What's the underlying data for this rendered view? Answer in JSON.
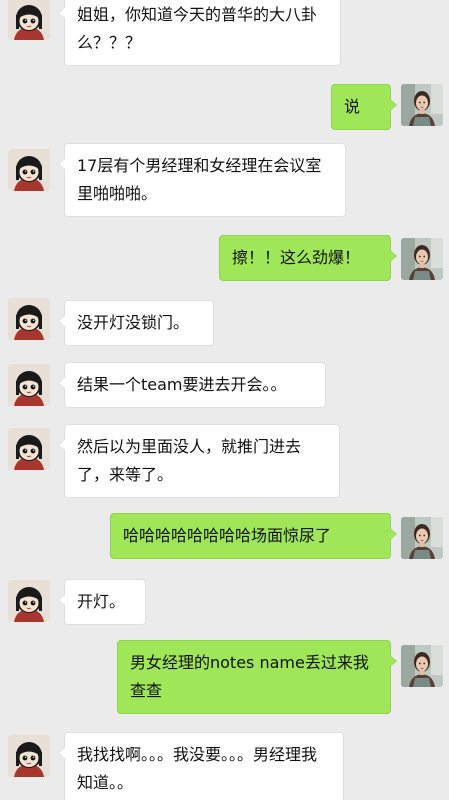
{
  "messages": [
    {
      "side": "left",
      "text": "姐姐，你知道今天的普华的大八卦么？？？"
    },
    {
      "side": "right",
      "text": "说"
    },
    {
      "side": "left",
      "text": "17层有个男经理和女经理在会议室里啪啪啪。"
    },
    {
      "side": "right",
      "text": "擦！！这么劲爆！"
    },
    {
      "side": "left",
      "text": "没开灯没锁门。"
    },
    {
      "side": "left",
      "text": "结果一个team要进去开会。。"
    },
    {
      "side": "left",
      "text": "然后以为里面没人，就推门进去了，来等了。"
    },
    {
      "side": "right",
      "text": "哈哈哈哈哈哈哈哈场面惊尿了"
    },
    {
      "side": "left",
      "text": "开灯。"
    },
    {
      "side": "right",
      "text": "男女经理的notes name丢过来我查查"
    },
    {
      "side": "left",
      "text": "我找找啊。。。我没要。。。男经理我知道。。"
    }
  ],
  "avatars": {
    "left_icon": "cartoon-girl-avatar-icon",
    "right_icon": "photo-woman-avatar-icon"
  },
  "colors": {
    "background": "#ebebeb",
    "bubble_left": "#ffffff",
    "bubble_right": "#9fe658"
  }
}
